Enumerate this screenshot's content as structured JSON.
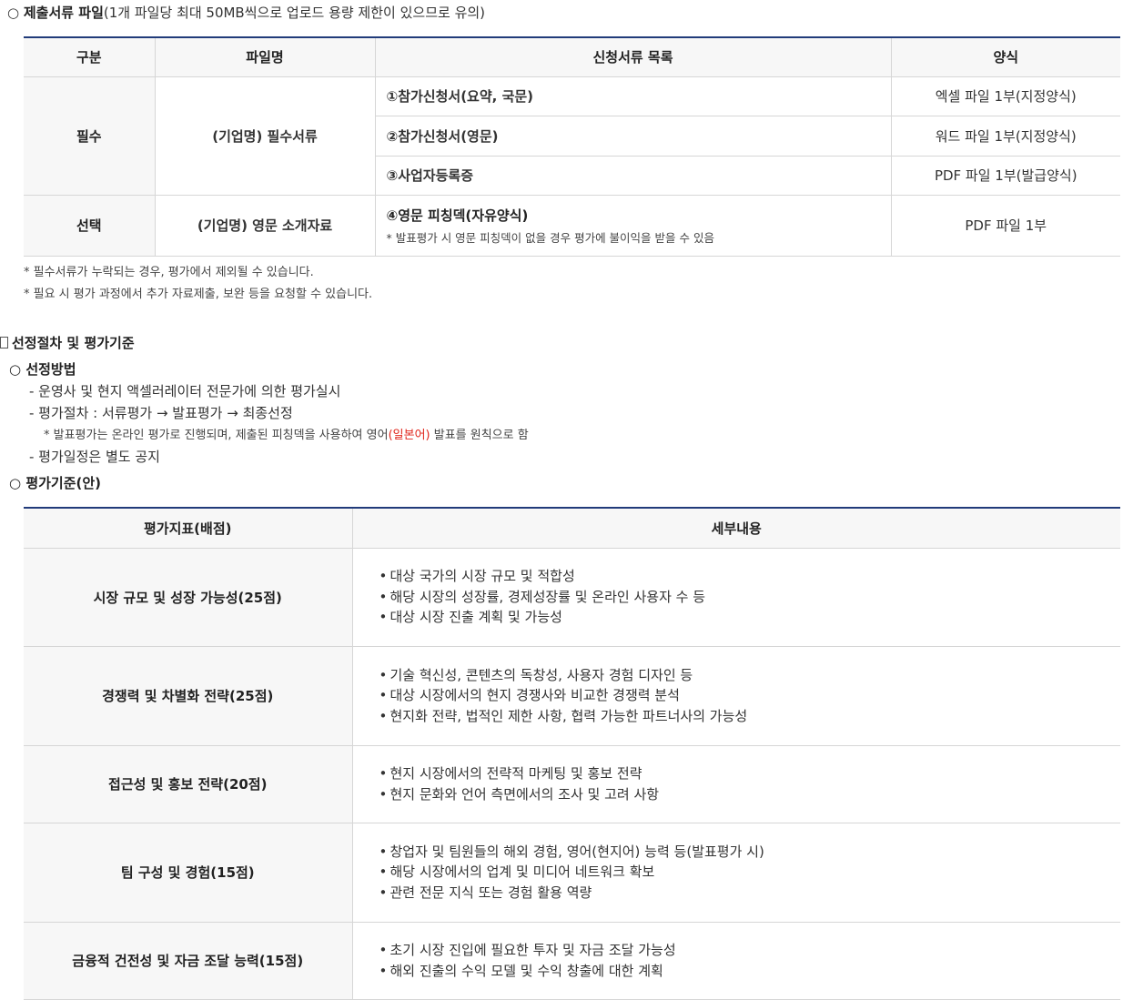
{
  "section1": {
    "heading_marker": "○",
    "heading_title": "제출서류 파일",
    "heading_note": "(1개 파일당 최대 50MB씩으로 업로드 용량 제한이 있으므로 유의)",
    "table": {
      "headers": [
        "구분",
        "파일명",
        "신청서류 목록",
        "양식"
      ],
      "group_required": "필수",
      "group_required_file": "(기업명) 필수서류",
      "required_rows": [
        {
          "doc": "①참가신청서(요약, 국문)",
          "form": "엑셀 파일 1부(지정양식)"
        },
        {
          "doc": "②참가신청서(영문)",
          "form": "워드 파일 1부(지정양식)"
        },
        {
          "doc": "③사업자등록증",
          "form": "PDF 파일 1부(발급양식)"
        }
      ],
      "group_optional": "선택",
      "group_optional_file": "(기업명) 영문 소개자료",
      "optional_doc": "④영문 피칭덱(자유양식)",
      "optional_doc_note": "* 발표평가 시 영문 피칭덱이 없을 경우 평가에 불이익을 받을 수 있음",
      "optional_form": "PDF 파일 1부"
    },
    "notes": [
      "* 필수서류가 누락되는 경우, 평가에서 제외될 수 있습니다.",
      "* 필요 시 평가 과정에서 추가 자료제출, 보완 등을 요청할 수 있습니다."
    ]
  },
  "section2": {
    "title": "선정절차 및 평가기준",
    "method_marker": "○",
    "method_title": "선정방법",
    "method_items": [
      "- 운영사 및 현지 액셀러레이터 전문가에 의한 평가실시",
      "- 평가절차 : 서류평가 → 발표평가 → 최종선정"
    ],
    "method_subnote_before": "* 발표평가는 온라인 평가로 진행되며, 제출된 피칭덱을 사용하여 영어",
    "method_subnote_red": "(일본어)",
    "method_subnote_after": " 발표를 원칙으로 함",
    "method_last": "- 평가일정은 별도 공지",
    "criteria_marker": "○",
    "criteria_title": "평가기준(안)",
    "criteria_table": {
      "headers": [
        "평가지표(배점)",
        "세부내용"
      ],
      "rows": [
        {
          "indicator": "시장 규모 및 성장 가능성(25점)",
          "details": [
            "대상 국가의 시장 규모 및 적합성",
            "해당 시장의 성장률, 경제성장률 및 온라인 사용자 수 등",
            "대상 시장 진출 계획 및 가능성"
          ]
        },
        {
          "indicator": "경쟁력 및 차별화 전략(25점)",
          "details": [
            "기술 혁신성, 콘텐츠의 독창성, 사용자 경험 디자인 등",
            "대상 시장에서의 현지 경쟁사와 비교한 경쟁력 분석",
            "현지화 전략, 법적인 제한 사항, 협력 가능한 파트너사의 가능성"
          ]
        },
        {
          "indicator": "접근성 및 홍보 전략(20점)",
          "details": [
            "현지 시장에서의 전략적 마케팅 및 홍보 전략",
            "현지 문화와 언어 측면에서의 조사 및 고려 사항"
          ]
        },
        {
          "indicator": "팀 구성 및 경험(15점)",
          "details": [
            "창업자 및 팀원들의 해외 경험, 영어(현지어) 능력 등(발표평가 시)",
            "해당 시장에서의 업계 및 미디어 네트워크 확보",
            "관련 전문 지식 또는 경험 활용 역량"
          ]
        },
        {
          "indicator": "금융적 건전성 및 자금 조달 능력(15점)",
          "details": [
            "초기 시장 진입에 필요한 투자 및 자금 조달 가능성",
            "해외 진출의 수익 모델 및 수익 창출에 대한 계획"
          ]
        }
      ]
    }
  }
}
